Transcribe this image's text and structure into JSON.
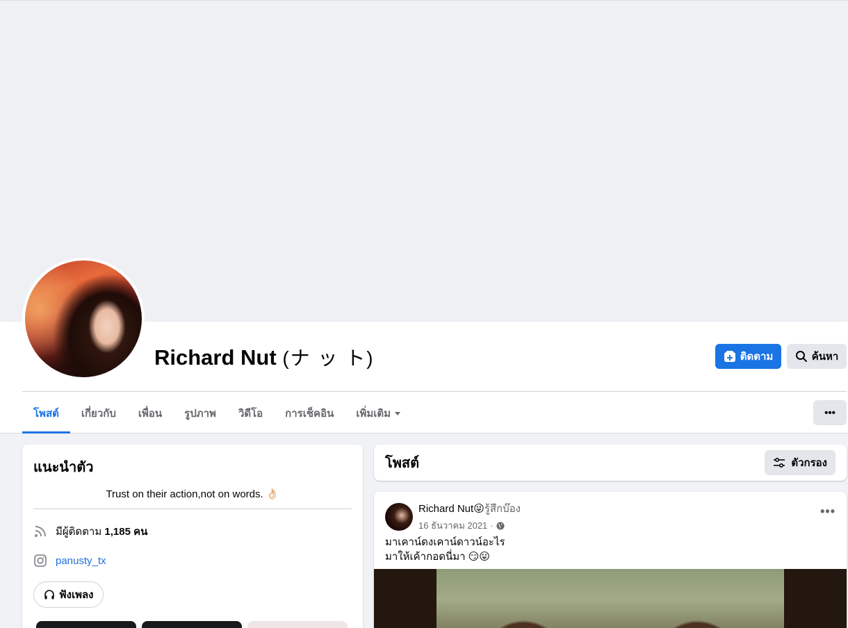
{
  "profile": {
    "name": "Richard Nut",
    "alt_name": "(ナ ッ ト)",
    "follow_label": "ติดตาม",
    "search_label": "ค้นหา",
    "more_label": "•••"
  },
  "tabs": [
    {
      "label": "โพสต์",
      "active": true
    },
    {
      "label": "เกี่ยวกับ"
    },
    {
      "label": "เพื่อน"
    },
    {
      "label": "รูปภาพ"
    },
    {
      "label": "วิดีโอ"
    },
    {
      "label": "การเช็คอิน"
    },
    {
      "label": "เพิ่มเติม"
    }
  ],
  "intro": {
    "title": "แนะนำตัว",
    "bio": "Trust on their action,not on words. 👌🏻",
    "followers_prefix": "มีผู้ติดตาม",
    "followers_count": "1,185 คน",
    "instagram": "panusty_tx",
    "music_label": "ฟังเพลง"
  },
  "posts": {
    "title": "โพสต์",
    "filter_label": "ตัวกรอง"
  },
  "post": {
    "author": "Richard Nut",
    "emoji": "😜",
    "feeling": "รู้สึกบ๊อง",
    "date": "16 ธันวาคม 2021",
    "separator": "·",
    "line1": "มาเคาน์ดงเคาน์ดาวน์อะไร",
    "line2": "มาให้เค้ากอดนี่มา 😏😛",
    "more_label": "•••"
  },
  "colors": {
    "accent": "#1b74e4",
    "background": "#f0f2f5",
    "button_gray": "#e4e6eb"
  }
}
